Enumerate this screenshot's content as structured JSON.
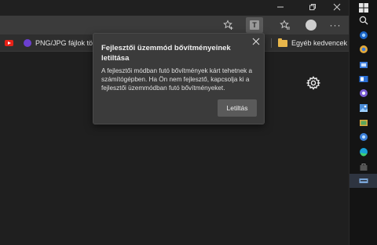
{
  "window": {
    "minimize_icon": "minimize-icon",
    "maximize_icon": "restore-icon",
    "close_icon": "close-icon"
  },
  "toolbar": {
    "icons": [
      "add-favorite-icon",
      "extension-icon",
      "favorites-icon",
      "profile-icon",
      "more-icon"
    ],
    "extension_letter": "T",
    "more_label": "···"
  },
  "favorites_bar": {
    "items": [
      {
        "label": "",
        "icon": "youtube-icon"
      },
      {
        "label": "PNG/JPG fájlok töm...",
        "icon": "png-icon"
      }
    ],
    "overflow_label": "›",
    "other_favorites_label": "Egyéb kedvencek"
  },
  "popup": {
    "title": "Fejlesztői üzemmód bővítményeinek letiltása",
    "body": "A fejlesztői módban futó bővítmények kárt tehetnek a számítógépben. Ha Ön nem fejlesztő, kapcsolja ki a fejlesztői üzemmódban futó bővítményeket.",
    "button_label": "Letiltás"
  },
  "colors": {
    "background": "#1f1f1f",
    "toolbar": "#3b3b3b",
    "popup": "#3b3b3b",
    "accent_button": "#5a5a5a"
  },
  "taskbar": {
    "icons": [
      "windows-icon",
      "search-icon",
      "edge-dev-icon",
      "chrome-icon",
      "mail-icon",
      "outlook-icon",
      "viber-icon",
      "photos-icon",
      "gallery-icon",
      "settings-app-icon",
      "edge-icon",
      "store-icon",
      "keyboard-icon"
    ]
  }
}
